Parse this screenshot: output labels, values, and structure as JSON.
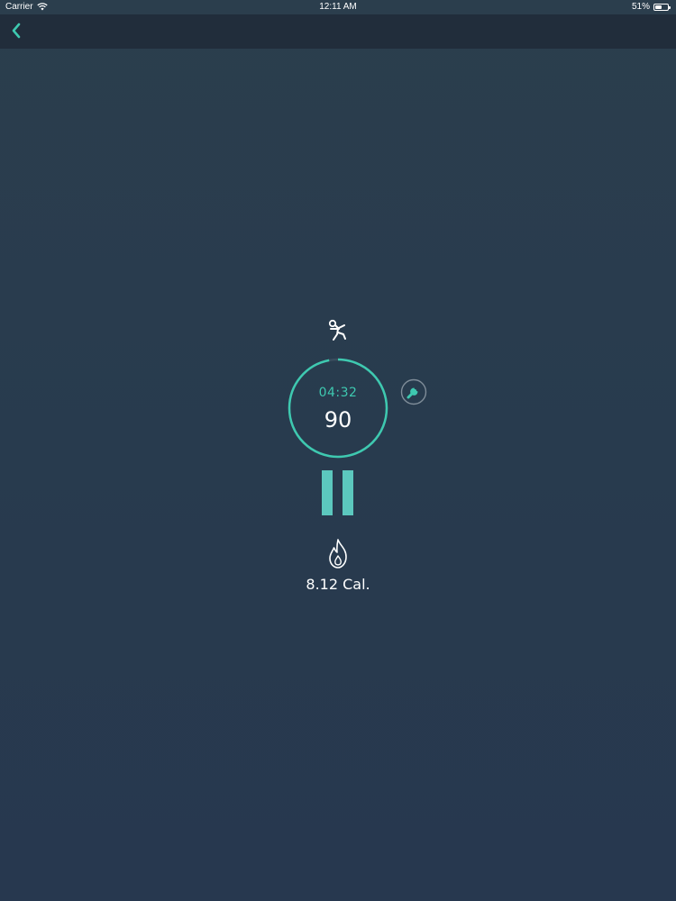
{
  "status_bar": {
    "carrier": "Carrier",
    "time": "12:11 AM",
    "battery_percent": "51%",
    "battery_level": 0.51
  },
  "nav": {
    "back_icon": "chevron-left-icon"
  },
  "workout": {
    "activity_icon": "jump-rope-figure-icon",
    "elapsed_time": "04:32",
    "count": "90",
    "progress": 0.97,
    "settings_icon": "wrench-icon",
    "pause_icon": "pause-icon",
    "calories_icon": "flame-icon",
    "calories": "8.12 Cal."
  },
  "colors": {
    "accent": "#3ec9b0",
    "pause": "#5cc8be",
    "background": "#293b4d",
    "nav_background": "#212d3b",
    "text": "#ffffff"
  }
}
